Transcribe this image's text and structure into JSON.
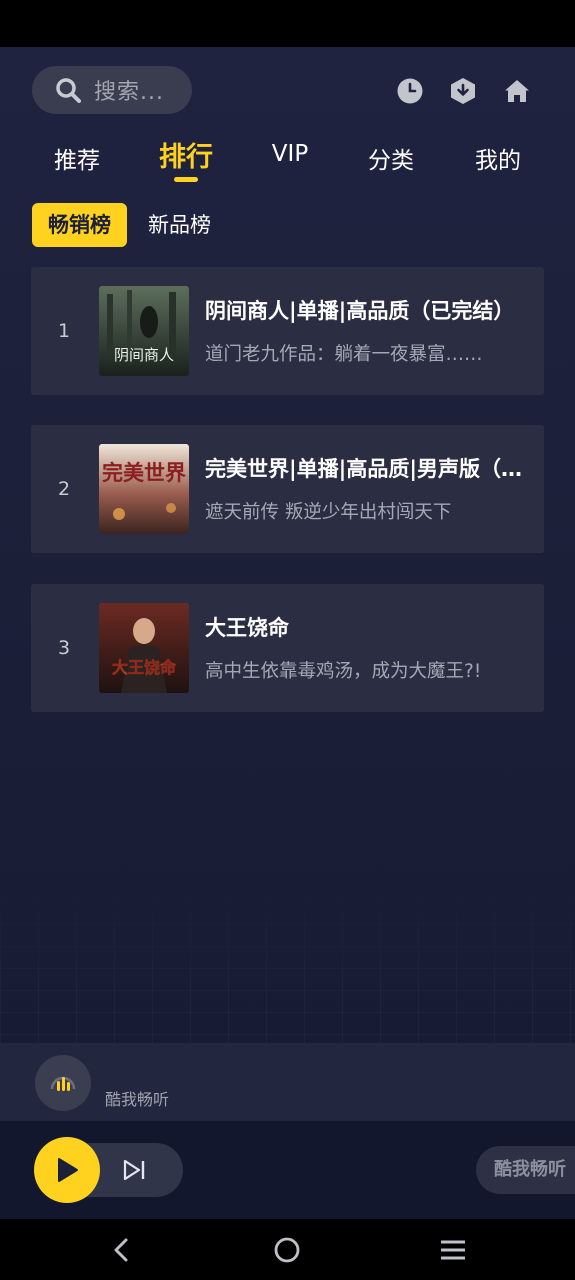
{
  "search": {
    "placeholder": "搜索..."
  },
  "header_icons": [
    "history-icon",
    "download-icon",
    "home-icon"
  ],
  "tabs": [
    {
      "label": "推荐",
      "active": false
    },
    {
      "label": "排行",
      "active": true
    },
    {
      "label": "VIP",
      "active": false
    },
    {
      "label": "分类",
      "active": false
    },
    {
      "label": "我的",
      "active": false
    }
  ],
  "subtabs": [
    {
      "label": "畅销榜",
      "active": true
    },
    {
      "label": "新品榜",
      "active": false
    }
  ],
  "ranking": [
    {
      "rank": "1",
      "title": "阴间商人|单播|高品质（已完结）",
      "desc": "道门老九作品：躺着一夜暴富……",
      "cover_text": "阴间商人"
    },
    {
      "rank": "2",
      "title": "完美世界|单播|高品质|男声版（已完结）",
      "desc": "遮天前传 叛逆少年出村闯天下",
      "cover_text": "完美世界"
    },
    {
      "rank": "3",
      "title": "大王饶命",
      "desc": "高中生依靠毒鸡汤，成为大魔王?!",
      "cover_text": "大王饶命"
    }
  ],
  "now_playing": {
    "label": "酷我畅听"
  },
  "player": {
    "brand": "酷我畅听"
  },
  "colors": {
    "accent": "#ffd21f",
    "background": "#1b1f38",
    "card": "#2b2e43"
  }
}
